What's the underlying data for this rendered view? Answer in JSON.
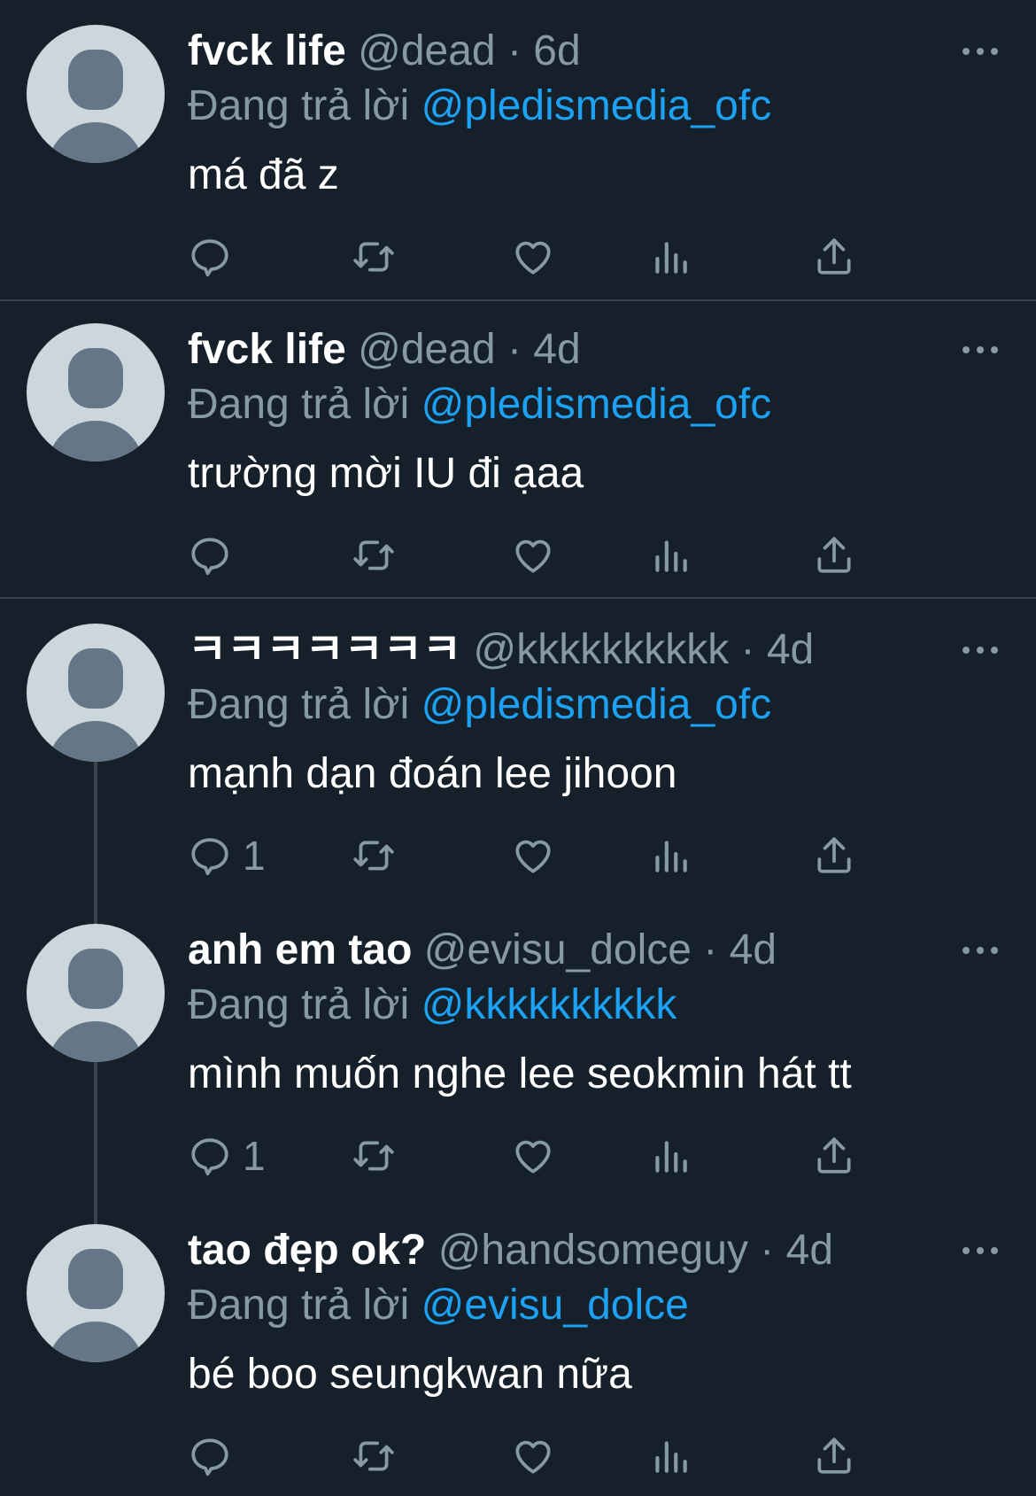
{
  "reply_prefix": "Đang trả lời",
  "sep": " · ",
  "tweets": [
    {
      "name": "fvck life",
      "handle": "@dead",
      "time": "6d",
      "reply_to": "@pledismedia_ofc",
      "text": "má đã z",
      "reply_count": ""
    },
    {
      "name": "fvck life",
      "handle": "@dead",
      "time": "4d",
      "reply_to": "@pledismedia_ofc",
      "text": "trường mời IU đi ạaa",
      "reply_count": ""
    },
    {
      "name": "ㅋㅋㅋㅋㅋㅋㅋ",
      "handle": "@kkkkkkkkkk",
      "time": "4d",
      "reply_to": "@pledismedia_ofc",
      "text": "mạnh dạn đoán lee jihoon",
      "reply_count": "1"
    },
    {
      "name": "anh em tao",
      "handle": "@evisu_dolce",
      "time": "4d",
      "reply_to": "@kkkkkkkkkk",
      "text": "mình muốn nghe lee seokmin hát tt",
      "reply_count": "1"
    },
    {
      "name": "tao đẹp ok?",
      "handle": "@handsomeguy",
      "time": "4d",
      "reply_to": "@evisu_dolce",
      "text": "bé boo seungkwan nữa",
      "reply_count": ""
    }
  ],
  "icons": [
    "reply-icon",
    "retweet-icon",
    "like-icon",
    "views-icon",
    "share-icon",
    "more-icon"
  ],
  "colors": {
    "background": "#15202b",
    "secondary_text": "#8899a6",
    "mention": "#1da1f2",
    "divider": "#38444d",
    "avatar_bg": "#ccd6dd",
    "avatar_fg": "#657786"
  }
}
